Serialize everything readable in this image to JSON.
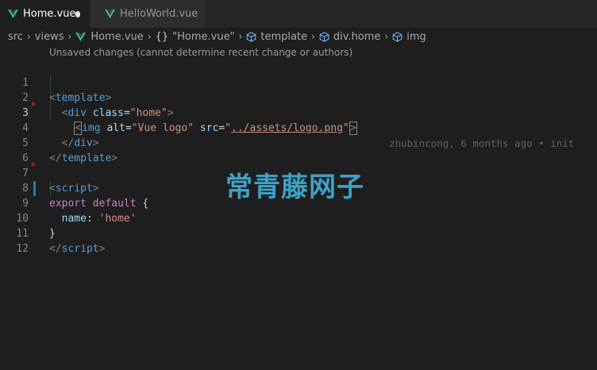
{
  "tabs": [
    {
      "label": "Home.vue",
      "active": true,
      "unsaved": true,
      "icon": "vue-icon"
    },
    {
      "label": "HelloWorld.vue",
      "active": false,
      "unsaved": false,
      "icon": "vue-icon"
    }
  ],
  "breadcrumb": {
    "items": [
      "src",
      "views",
      "Home.vue",
      "\"Home.vue\"",
      "template",
      "div.home",
      "img"
    ]
  },
  "editor": {
    "codelens": "Unsaved changes (cannot determine recent change or authors)",
    "line_numbers": [
      "1",
      "2",
      "3",
      "4",
      "5",
      "6",
      "7",
      "8",
      "9",
      "10",
      "11",
      "12"
    ],
    "blame": "zhubincong, 6 months ago • init",
    "code": {
      "l1_open": "<",
      "l1_tag": "template",
      "l1_close": ">",
      "l2_open": "<",
      "l2_tag": "div",
      "l2_attr": "class",
      "l2_eq": "=",
      "l2_val": "\"home\"",
      "l2_close": ">",
      "l3_open": "<",
      "l3_tag": "img",
      "l3_attr1": "alt",
      "l3_eq1": "=",
      "l3_val1": "\"Vue logo\"",
      "l3_attr2": "src",
      "l3_eq2": "=",
      "l3_q1": "\"",
      "l3_link": "../assets/logo.png",
      "l3_q2": "\"",
      "l3_close": ">",
      "l4_open": "</",
      "l4_tag": "div",
      "l4_close": ">",
      "l5_open": "</",
      "l5_tag": "template",
      "l5_close": ">",
      "l7_open": "<",
      "l7_tag": "script",
      "l7_close": ">",
      "l8_kw1": "export",
      "l8_kw2": "default",
      "l8_brace": "{",
      "l9_key": "name",
      "l9_colon": ":",
      "l9_val": "'home'",
      "l10_brace": "}",
      "l11_open": "</",
      "l11_tag": "script",
      "l11_close": ">"
    }
  },
  "watermark": "常青藤网子",
  "colors": {
    "accent": "#1b81a8",
    "vue_green": "#42b883",
    "background": "#1e1e1e"
  }
}
